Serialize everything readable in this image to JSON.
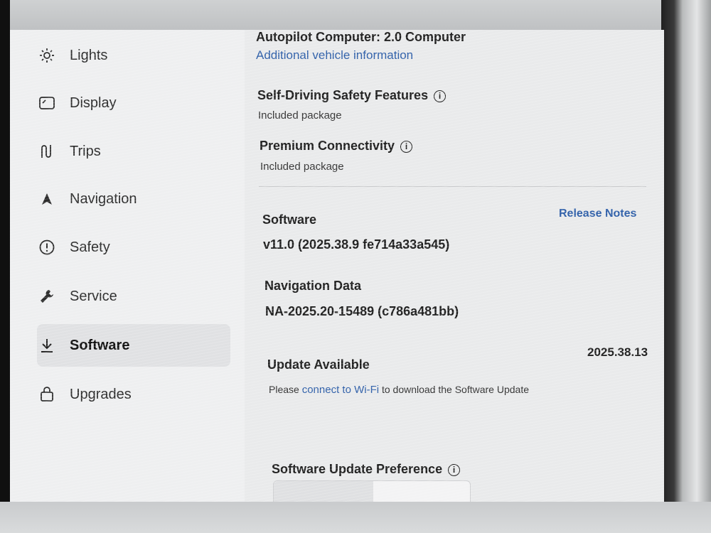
{
  "sidebar": {
    "items": [
      {
        "label": "Lights",
        "icon": "sun-icon"
      },
      {
        "label": "Display",
        "icon": "display-icon"
      },
      {
        "label": "Trips",
        "icon": "trips-icon"
      },
      {
        "label": "Navigation",
        "icon": "navigation-arrow-icon"
      },
      {
        "label": "Safety",
        "icon": "alert-circle-icon"
      },
      {
        "label": "Service",
        "icon": "wrench-icon"
      },
      {
        "label": "Software",
        "icon": "download-icon",
        "active": true
      },
      {
        "label": "Upgrades",
        "icon": "shopping-bag-icon"
      }
    ]
  },
  "vehicle": {
    "autopilot": "Autopilot Computer: 2.0 Computer",
    "additional_info_link": "Additional vehicle information"
  },
  "packages": [
    {
      "title": "Self-Driving Safety Features",
      "status": "Included package"
    },
    {
      "title": "Premium Connectivity",
      "status": "Included package"
    }
  ],
  "software": {
    "label": "Software",
    "release_notes": "Release Notes",
    "version": "v11.0 (2025.38.9 fe714a33a545)"
  },
  "navigation_data": {
    "label": "Navigation Data",
    "version": "NA-2025.20-15489 (c786a481bb)"
  },
  "update": {
    "label": "Update Available",
    "version": "2025.38.13",
    "message_prefix": "Please ",
    "message_link": "connect to Wi-Fi",
    "message_suffix": " to download the Software Update"
  },
  "preference": {
    "label": "Software Update Preference"
  },
  "colors": {
    "link": "#2d5ea8",
    "screen_bg": "#e9eaeb"
  }
}
